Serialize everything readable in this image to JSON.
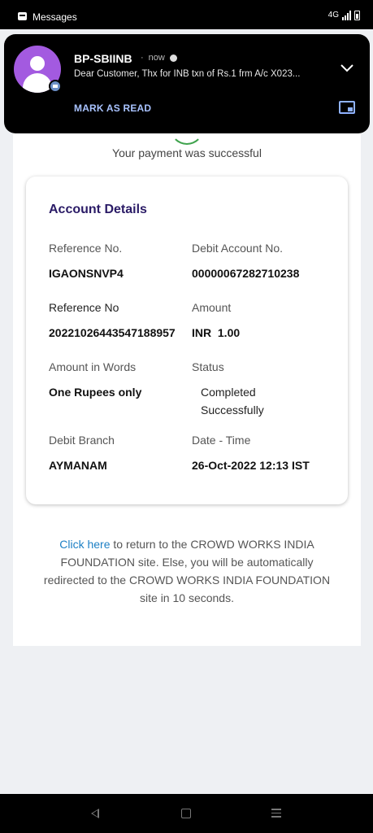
{
  "status_bar": {
    "app_name": "Messages",
    "indicators": "4G"
  },
  "notification": {
    "sender": "BP-SBIINB",
    "time": "now",
    "preview": "Dear Customer, Thx for INB txn of Rs.1 frm A/c X023...",
    "action_label": "MARK AS READ",
    "icons": [
      "avatar-person-icon",
      "message-badge-icon",
      "alarm-icon",
      "chevron-down-icon",
      "picture-in-picture-icon"
    ]
  },
  "page": {
    "success_message": "Your payment was successful",
    "details_heading": "Account Details",
    "fields": {
      "reference_no_label": "Reference No.",
      "reference_no_value": "IGAONSNVP4",
      "debit_account_label": "Debit Account No.",
      "debit_account_value": "00000067282710238",
      "reference_no2_label": "Reference No",
      "reference_no2_value": "20221026443547188957",
      "amount_label": "Amount",
      "amount_value": "INR  1.00",
      "amount_words_label": "Amount in Words",
      "amount_words_value": "One Rupees only",
      "status_label": "Status",
      "status_value_line1": "Completed",
      "status_value_line2": "Successfully",
      "debit_branch_label": "Debit Branch",
      "debit_branch_value": "AYMANAM",
      "date_time_label": "Date - Time",
      "date_time_value": "26-Oct-2022 12:13 IST"
    },
    "footer": {
      "link_text": "Click here",
      "line1_rest": " to return to the CROWD WORKS INDIA",
      "line2": "FOUNDATION site. Else, you will be automatically",
      "line3": "redirected to the CROWD WORKS INDIA FOUNDATION",
      "line4": "site in 10 seconds."
    }
  },
  "colors": {
    "heading": "#2a1b66",
    "link": "#1c7fc4",
    "success": "#3fa34d",
    "avatar": "#a35ae0",
    "action": "#a9c3ff"
  }
}
